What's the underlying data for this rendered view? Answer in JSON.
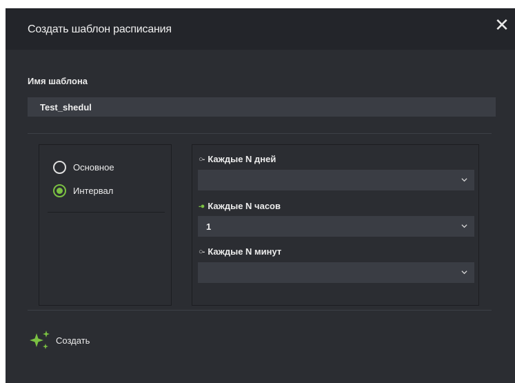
{
  "dialog": {
    "title": "Создать шаблон расписания",
    "close_icon": "close-icon"
  },
  "template_name": {
    "label": "Имя шаблона",
    "value": "Test_shedul"
  },
  "schedule_type": {
    "options": [
      {
        "label": "Основное",
        "checked": false
      },
      {
        "label": "Интервал",
        "checked": true
      }
    ]
  },
  "interval": {
    "days": {
      "label": "Каждые N дней",
      "marker": "○-",
      "active": false,
      "value": ""
    },
    "hours": {
      "label": "Каждые N часов",
      "marker": "-●",
      "active": true,
      "value": "1"
    },
    "minutes": {
      "label": "Каждые N минут",
      "marker": "○-",
      "active": false,
      "value": ""
    }
  },
  "actions": {
    "create_label": "Создать",
    "create_icon": "sparkle-icon"
  },
  "colors": {
    "accent": "#7bc142",
    "dialog_bg": "#2b2d32",
    "header_bg": "#23252a",
    "input_bg": "#3a3d44"
  }
}
